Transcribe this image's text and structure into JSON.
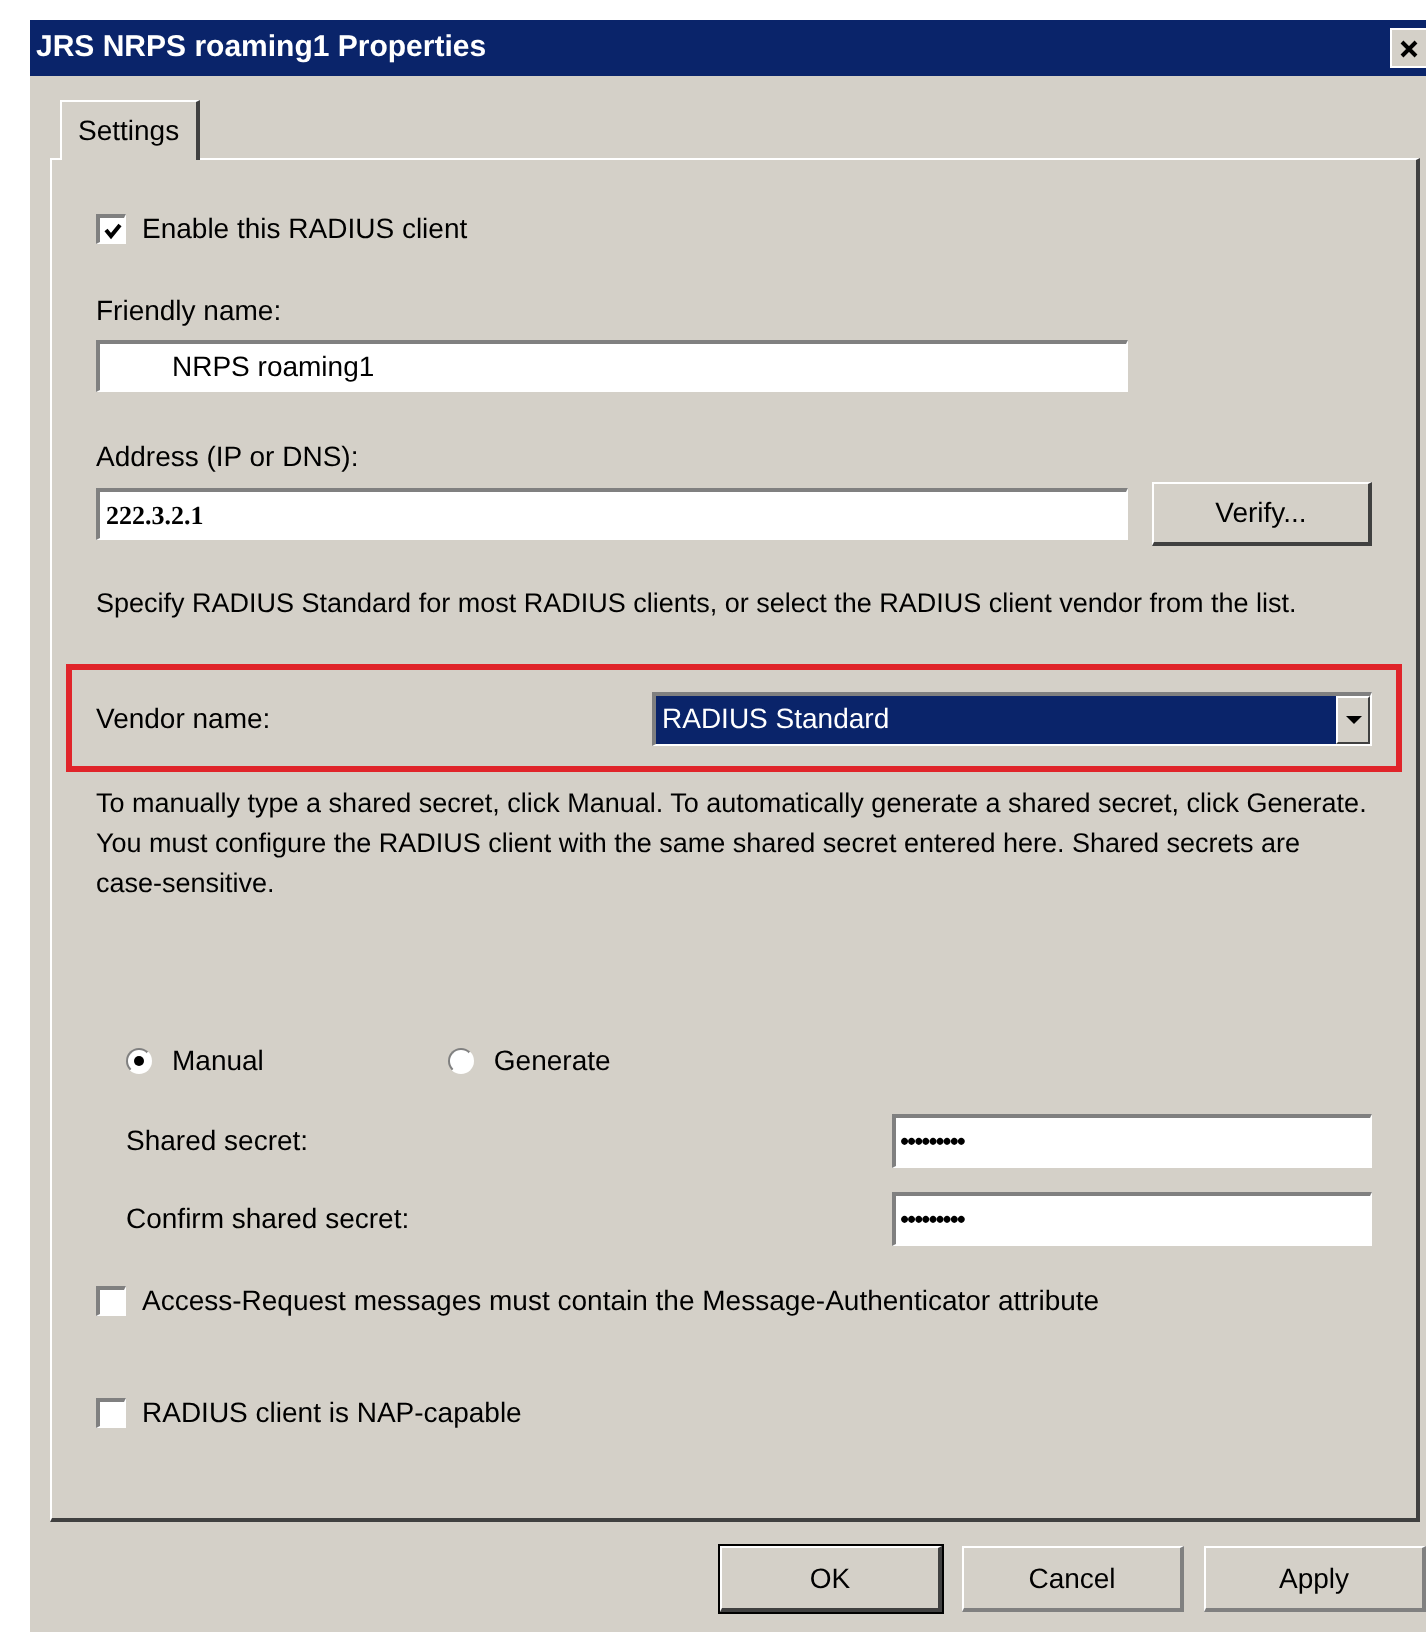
{
  "window": {
    "title": "JRS NRPS roaming1 Properties"
  },
  "tabs": [
    {
      "label": "Settings",
      "selected": true
    }
  ],
  "enable_client": {
    "label": "Enable this RADIUS client",
    "checked": true
  },
  "friendly_name": {
    "label": "Friendly name:",
    "value": "NRPS roaming1"
  },
  "address": {
    "label": "Address (IP or DNS):",
    "value": "222.3.2.1",
    "button": "Verify..."
  },
  "vendor_hint": "Specify RADIUS Standard for most RADIUS clients, or select the RADIUS client vendor from the list.",
  "vendor": {
    "label": "Vendor name:",
    "value": "RADIUS Standard",
    "highlighted": true
  },
  "secret_hint": "To manually type a shared secret, click Manual. To automatically generate a shared secret, click Generate. You must configure the RADIUS client with the same shared secret entered here. Shared secrets are case-sensitive.",
  "secret_modes": [
    {
      "label": "Manual",
      "selected": true
    },
    {
      "label": "Generate",
      "selected": false
    }
  ],
  "secret_fields": [
    {
      "label": "Shared secret:",
      "value": "•••••••••"
    },
    {
      "label": "Confirm shared secret:",
      "value": "•••••••••"
    }
  ],
  "options": [
    {
      "label": "Access-Request messages must contain the Message-Authenticator attribute",
      "checked": false
    },
    {
      "label": "RADIUS client is NAP-capable",
      "checked": false
    }
  ],
  "buttons": [
    {
      "label": "OK",
      "default": true
    },
    {
      "label": "Cancel",
      "default": false
    },
    {
      "label": "Apply",
      "default": false
    }
  ]
}
